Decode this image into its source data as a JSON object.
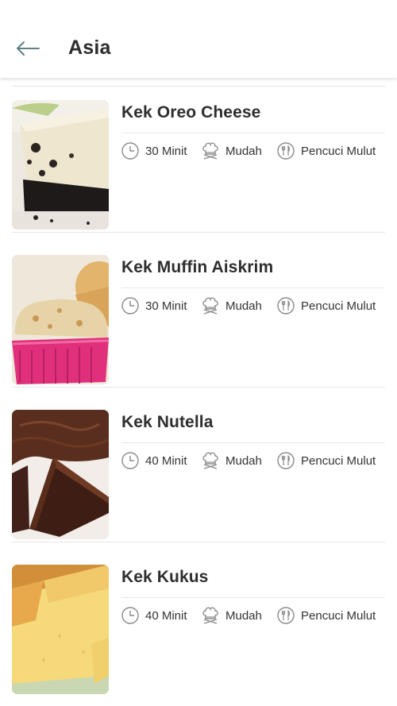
{
  "header": {
    "title": "Asia",
    "back_icon": "arrow-left-icon"
  },
  "recipes": [
    {
      "title": "Kek Oreo Cheese",
      "time": "30 Minit",
      "difficulty": "Mudah",
      "category": "Pencuci Mulut"
    },
    {
      "title": "Kek Muffin Aiskrim",
      "time": "30 Minit",
      "difficulty": "Mudah",
      "category": "Pencuci Mulut"
    },
    {
      "title": "Kek Nutella",
      "time": "40 Minit",
      "difficulty": "Mudah",
      "category": "Pencuci Mulut"
    },
    {
      "title": "Kek Kukus",
      "time": "40 Minit",
      "difficulty": "Mudah",
      "category": "Pencuci Mulut"
    }
  ],
  "icons": {
    "time": "clock-icon",
    "difficulty": "chef-hat-icon",
    "category": "cutlery-icon"
  },
  "colors": {
    "icon_stroke": "#8a8a8a",
    "back_arrow": "#5f7f86",
    "divider": "#e6e6e6"
  }
}
